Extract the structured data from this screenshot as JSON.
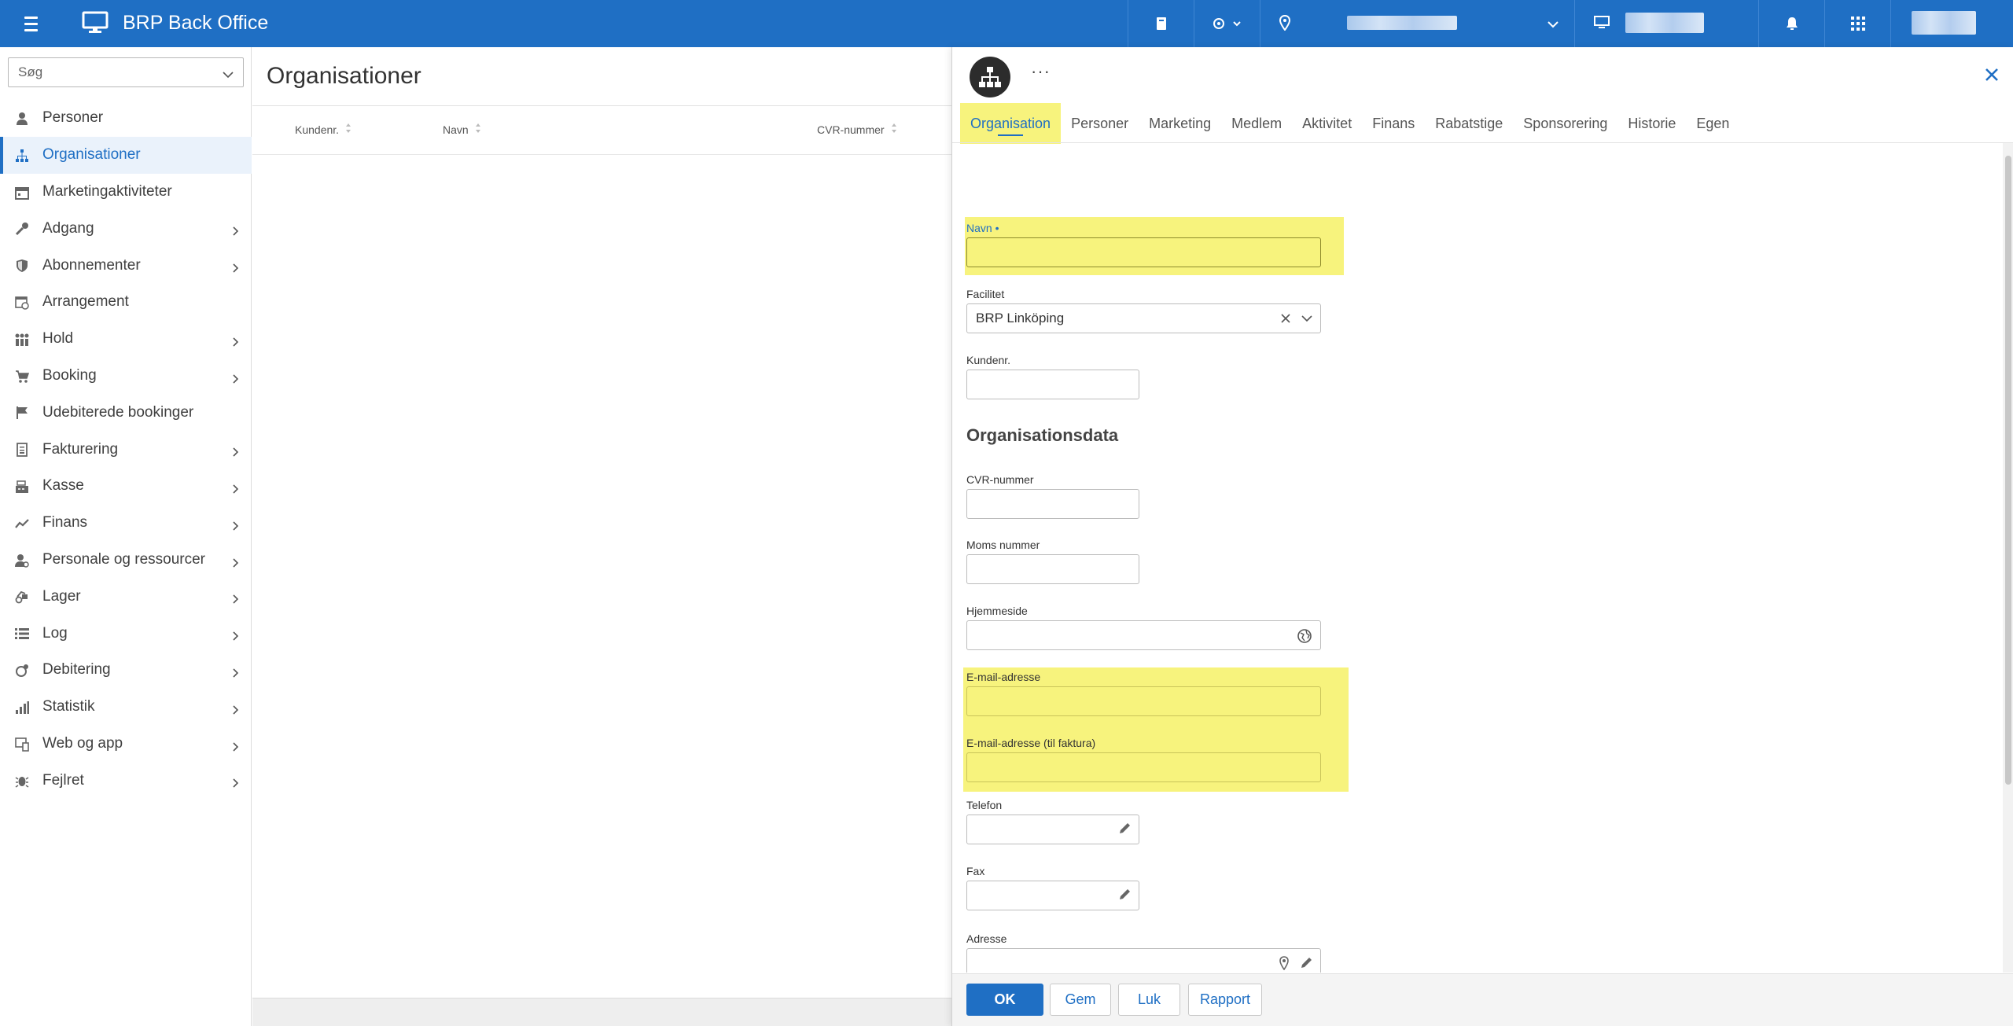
{
  "app": {
    "title": "BRP Back Office"
  },
  "topbar": {
    "icons": [
      "menu-icon",
      "monitor-icon",
      "book-icon",
      "tag-settings-icon",
      "location-pin-icon",
      "desktop-icon",
      "bell-icon",
      "apps-grid-icon"
    ]
  },
  "sidebar": {
    "search_placeholder": "Søg",
    "items": [
      {
        "label": "Personer",
        "icon": "person-icon",
        "has_children": false
      },
      {
        "label": "Organisationer",
        "icon": "org-chart-icon",
        "has_children": false,
        "active": true
      },
      {
        "label": "Marketingaktiviteter",
        "icon": "calendar-icon",
        "has_children": false
      },
      {
        "label": "Adgang",
        "icon": "key-icon",
        "has_children": true
      },
      {
        "label": "Abonnementer",
        "icon": "shield-icon",
        "has_children": true
      },
      {
        "label": "Arrangement",
        "icon": "calendar-clock-icon",
        "has_children": false
      },
      {
        "label": "Hold",
        "icon": "group-icon",
        "has_children": true
      },
      {
        "label": "Booking",
        "icon": "cart-icon",
        "has_children": true
      },
      {
        "label": "Udebiterede bookinger",
        "icon": "flag-icon",
        "has_children": false
      },
      {
        "label": "Fakturering",
        "icon": "invoice-icon",
        "has_children": true
      },
      {
        "label": "Kasse",
        "icon": "cash-register-icon",
        "has_children": true
      },
      {
        "label": "Finans",
        "icon": "trend-icon",
        "has_children": true
      },
      {
        "label": "Personale og ressourcer",
        "icon": "staff-icon",
        "has_children": true
      },
      {
        "label": "Lager",
        "icon": "warehouse-icon",
        "has_children": true
      },
      {
        "label": "Log",
        "icon": "list-icon",
        "has_children": true
      },
      {
        "label": "Debitering",
        "icon": "debit-icon",
        "has_children": true
      },
      {
        "label": "Statistik",
        "icon": "bar-chart-icon",
        "has_children": true
      },
      {
        "label": "Web og app",
        "icon": "web-icon",
        "has_children": true
      },
      {
        "label": "Fejlret",
        "icon": "bug-icon",
        "has_children": true
      }
    ]
  },
  "main": {
    "title": "Organisationer",
    "columns": [
      "Kundenr.",
      "Navn",
      "CVR-nummer"
    ]
  },
  "dialog": {
    "avatar_icon": "org-chart-icon",
    "more_label": "···",
    "tabs": [
      "Organisation",
      "Personer",
      "Marketing",
      "Medlem",
      "Aktivitet",
      "Finans",
      "Rabatstige",
      "Sponsorering",
      "Historie",
      "Egen"
    ],
    "active_tab": "Organisation",
    "fields": {
      "navn": {
        "label": "Navn",
        "required_mark": "•",
        "value": ""
      },
      "facilitet": {
        "label": "Facilitet",
        "value": "BRP Linköping"
      },
      "kundenr": {
        "label": "Kundenr.",
        "value": ""
      },
      "section_title": "Organisationsdata",
      "cvr": {
        "label": "CVR-nummer",
        "value": ""
      },
      "moms": {
        "label": "Moms nummer",
        "value": ""
      },
      "hjemmeside": {
        "label": "Hjemmeside",
        "value": ""
      },
      "email": {
        "label": "E-mail-adresse",
        "value": ""
      },
      "email_faktura": {
        "label": "E-mail-adresse (til faktura)",
        "value": ""
      },
      "telefon": {
        "label": "Telefon",
        "value": ""
      },
      "fax": {
        "label": "Fax",
        "value": ""
      },
      "adresse": {
        "label": "Adresse",
        "value": ""
      }
    },
    "buttons": {
      "ok": "OK",
      "gem": "Gem",
      "luk": "Luk",
      "rapport": "Rapport"
    }
  },
  "colors": {
    "brand": "#1f6fc4",
    "highlight": "#f7f37d"
  }
}
